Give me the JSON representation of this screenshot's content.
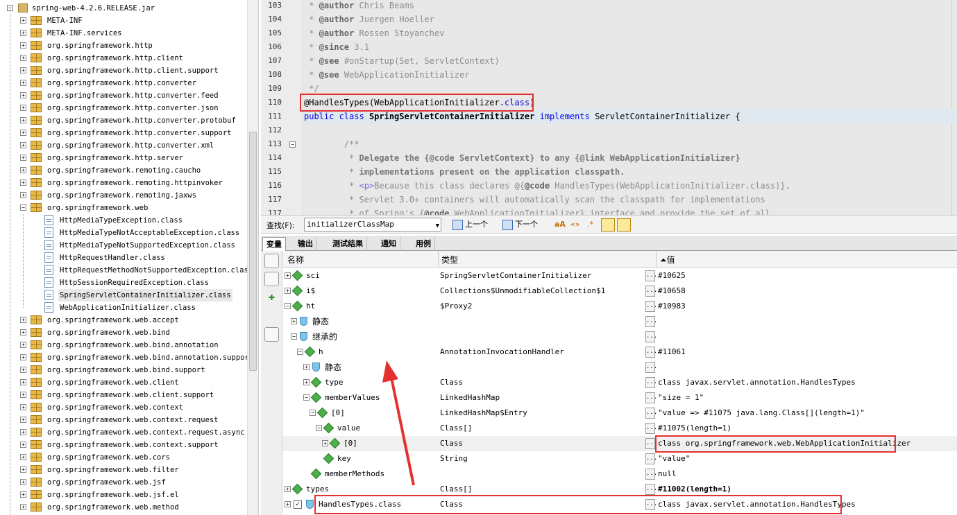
{
  "tree": {
    "root": "spring-web-4.2.6.RELEASE.jar",
    "items": [
      {
        "label": "META-INF",
        "kind": "pkg",
        "level": 1
      },
      {
        "label": "META-INF.services",
        "kind": "pkg",
        "level": 1
      },
      {
        "label": "org.springframework.http",
        "kind": "pkg",
        "level": 1
      },
      {
        "label": "org.springframework.http.client",
        "kind": "pkg",
        "level": 1
      },
      {
        "label": "org.springframework.http.client.support",
        "kind": "pkg",
        "level": 1
      },
      {
        "label": "org.springframework.http.converter",
        "kind": "pkg",
        "level": 1
      },
      {
        "label": "org.springframework.http.converter.feed",
        "kind": "pkg",
        "level": 1
      },
      {
        "label": "org.springframework.http.converter.json",
        "kind": "pkg",
        "level": 1
      },
      {
        "label": "org.springframework.http.converter.protobuf",
        "kind": "pkg",
        "level": 1
      },
      {
        "label": "org.springframework.http.converter.support",
        "kind": "pkg",
        "level": 1
      },
      {
        "label": "org.springframework.http.converter.xml",
        "kind": "pkg",
        "level": 1
      },
      {
        "label": "org.springframework.http.server",
        "kind": "pkg",
        "level": 1
      },
      {
        "label": "org.springframework.remoting.caucho",
        "kind": "pkg",
        "level": 1
      },
      {
        "label": "org.springframework.remoting.httpinvoker",
        "kind": "pkg",
        "level": 1
      },
      {
        "label": "org.springframework.remoting.jaxws",
        "kind": "pkg",
        "level": 1
      },
      {
        "label": "org.springframework.web",
        "kind": "pkg",
        "level": 1,
        "expanded": true
      },
      {
        "label": "HttpMediaTypeException.class",
        "kind": "cls",
        "level": 2
      },
      {
        "label": "HttpMediaTypeNotAcceptableException.class",
        "kind": "cls",
        "level": 2
      },
      {
        "label": "HttpMediaTypeNotSupportedException.class",
        "kind": "cls",
        "level": 2
      },
      {
        "label": "HttpRequestHandler.class",
        "kind": "cls",
        "level": 2
      },
      {
        "label": "HttpRequestMethodNotSupportedException.class",
        "kind": "cls",
        "level": 2
      },
      {
        "label": "HttpSessionRequiredException.class",
        "kind": "cls",
        "level": 2
      },
      {
        "label": "SpringServletContainerInitializer.class",
        "kind": "cls",
        "level": 2,
        "selected": true
      },
      {
        "label": "WebApplicationInitializer.class",
        "kind": "cls",
        "level": 2
      },
      {
        "label": "org.springframework.web.accept",
        "kind": "pkg",
        "level": 1
      },
      {
        "label": "org.springframework.web.bind",
        "kind": "pkg",
        "level": 1
      },
      {
        "label": "org.springframework.web.bind.annotation",
        "kind": "pkg",
        "level": 1
      },
      {
        "label": "org.springframework.web.bind.annotation.support",
        "kind": "pkg",
        "level": 1
      },
      {
        "label": "org.springframework.web.bind.support",
        "kind": "pkg",
        "level": 1
      },
      {
        "label": "org.springframework.web.client",
        "kind": "pkg",
        "level": 1
      },
      {
        "label": "org.springframework.web.client.support",
        "kind": "pkg",
        "level": 1
      },
      {
        "label": "org.springframework.web.context",
        "kind": "pkg",
        "level": 1
      },
      {
        "label": "org.springframework.web.context.request",
        "kind": "pkg",
        "level": 1
      },
      {
        "label": "org.springframework.web.context.request.async",
        "kind": "pkg",
        "level": 1
      },
      {
        "label": "org.springframework.web.context.support",
        "kind": "pkg",
        "level": 1
      },
      {
        "label": "org.springframework.web.cors",
        "kind": "pkg",
        "level": 1
      },
      {
        "label": "org.springframework.web.filter",
        "kind": "pkg",
        "level": 1
      },
      {
        "label": "org.springframework.web.jsf",
        "kind": "pkg",
        "level": 1
      },
      {
        "label": "org.springframework.web.jsf.el",
        "kind": "pkg",
        "level": 1
      },
      {
        "label": "org.springframework.web.method",
        "kind": "pkg",
        "level": 1
      }
    ]
  },
  "editor": {
    "lines": [
      {
        "n": "103",
        "html": " * <b>@author</b> Chris Beams"
      },
      {
        "n": "104",
        "html": " * <b>@author</b> Juergen Hoeller"
      },
      {
        "n": "105",
        "html": " * <b>@author</b> Rossen Stoyanchev"
      },
      {
        "n": "106",
        "html": " * <b>@since</b> 3.1"
      },
      {
        "n": "107",
        "html": " * <b>@see</b> #onStartup(Set, ServletContext)"
      },
      {
        "n": "108",
        "html": " * <b>@see</b> WebApplicationInitializer"
      },
      {
        "n": "109",
        "html": " */"
      },
      {
        "n": "110",
        "html": "<span style=\"color:#000\">@HandlesTypes(WebApplicationInitializer.</span><span class=\"kw\">class</span><span style=\"color:#000\">)</span>"
      },
      {
        "n": "111",
        "html": "<span class=\"kw\">public class</span> <span class=\"bold\">SpringServletContainerInitializer</span> <span class=\"kw\">implements</span> <span style=\"color:#000\">ServletContainerInitializer {</span>",
        "hl": true
      },
      {
        "n": "112",
        "html": ""
      },
      {
        "n": "113",
        "html": "        /**",
        "fold": true
      },
      {
        "n": "114",
        "html": "         * <span class=\"bold\" style=\"color:#777\">Delegate the {@code ServletContext} to any {@link WebApplicationInitializer}</span>"
      },
      {
        "n": "115",
        "html": "         * <span class=\"bold\" style=\"color:#777\">implementations present on the application classpath.</span>"
      },
      {
        "n": "116",
        "html": "         * <span class=\"kw\" style=\"color:#7070e0\">&lt;p&gt;</span>Because this class declares @{<b>@code</b> HandlesTypes(WebApplicationInitializer.class)},"
      },
      {
        "n": "117",
        "html": "         * Servlet 3.0+ containers will automatically scan the classpath for implementations"
      },
      {
        "n": "117",
        "html": "         * of Spring's {<b>@code</b> WebApplicationInitializer} interface and provide the set of all"
      }
    ]
  },
  "find": {
    "label": "查找(F):",
    "value": "initializerClassMap",
    "prev": "上一个",
    "next": "下一个"
  },
  "tabs": [
    "变量",
    "输出",
    "测试结果",
    "通知",
    "用例"
  ],
  "vars": {
    "headers": {
      "name": "名称",
      "type": "类型",
      "value": "值"
    },
    "rows": [
      {
        "indent": 0,
        "exp": "+",
        "icon": "dia",
        "name": "sci",
        "type": "SpringServletContainerInitializer",
        "value": "#10625"
      },
      {
        "indent": 0,
        "exp": "+",
        "icon": "dia",
        "name": "i$",
        "type": "Collections$UnmodifiableCollection$1",
        "value": "#10658"
      },
      {
        "indent": 0,
        "exp": "-",
        "icon": "dia",
        "name": "ht",
        "type": "$Proxy2",
        "value": "#10983"
      },
      {
        "indent": 1,
        "exp": "+",
        "icon": "shield",
        "name": "静态",
        "type": "",
        "value": ""
      },
      {
        "indent": 1,
        "exp": "-",
        "icon": "shield",
        "name": "继承的",
        "type": "",
        "value": ""
      },
      {
        "indent": 2,
        "exp": "-",
        "icon": "dia",
        "name": "h",
        "type": "AnnotationInvocationHandler",
        "value": "#11061"
      },
      {
        "indent": 3,
        "exp": "+",
        "icon": "shield",
        "name": "静态",
        "type": "",
        "value": ""
      },
      {
        "indent": 3,
        "exp": "+",
        "icon": "dia",
        "name": "type",
        "type": "Class",
        "value": "class javax.servlet.annotation.HandlesTypes"
      },
      {
        "indent": 3,
        "exp": "-",
        "icon": "dia",
        "name": "memberValues",
        "type": "LinkedHashMap",
        "value": "\"size = 1\""
      },
      {
        "indent": 4,
        "exp": "-",
        "icon": "dia",
        "name": "[0]",
        "type": "LinkedHashMap$Entry",
        "value": "\"value => #11075 java.lang.Class[](length=1)\""
      },
      {
        "indent": 5,
        "exp": "-",
        "icon": "dia",
        "name": "value",
        "type": "Class[]",
        "value": "#11075(length=1)"
      },
      {
        "indent": 6,
        "exp": "+",
        "icon": "dia",
        "name": "[0]",
        "type": "Class",
        "value": "class org.springframework.web.WebApplicationInitializer",
        "sel": true
      },
      {
        "indent": 5,
        "exp": "",
        "icon": "dia",
        "name": "key",
        "type": "String",
        "value": "\"value\""
      },
      {
        "indent": 3,
        "exp": "",
        "icon": "dia",
        "name": "memberMethods",
        "type": "",
        "value": "null"
      },
      {
        "indent": 0,
        "exp": "+",
        "icon": "dia",
        "name": "types",
        "type": "Class[]",
        "value": "#11002(length=1)",
        "bold": true
      },
      {
        "indent": 0,
        "exp": "+",
        "icon": "chk",
        "name": "HandlesTypes.class",
        "type": "Class",
        "value": "class javax.servlet.annotation.HandlesTypes"
      }
    ]
  },
  "colors": {
    "highlight_box": "#e53030",
    "keyword": "#0000e6",
    "pkg_icon": "#e8b84a",
    "node_icon": "#4cae4c"
  }
}
